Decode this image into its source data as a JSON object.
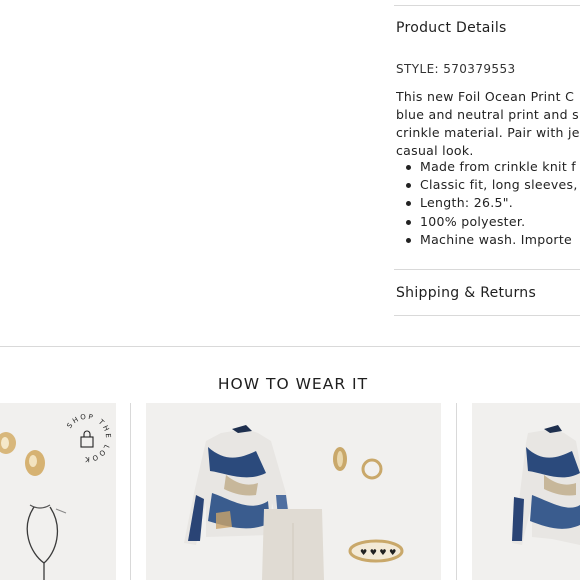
{
  "details": {
    "title": "Product Details",
    "style": "STYLE: 570379553",
    "description_lines": [
      "This new Foil Ocean Print C",
      "blue and neutral print and s",
      "crinkle material. Pair with je",
      "casual look."
    ],
    "bullets": [
      "Made from crinkle knit f",
      "Classic fit, long sleeves,",
      "Length: 26.5\".",
      "100% polyester.",
      "Machine wash. Importe"
    ]
  },
  "shipping": {
    "title": "Shipping & Returns"
  },
  "how_to_wear": {
    "title": "HOW TO WEAR IT",
    "shop_the_look": "SHOP THE LOOK"
  },
  "colors": {
    "rule": "#d9d9d9",
    "card_bg": "#f1f0ee",
    "navy": "#24406e",
    "gold": "#c9a86a"
  }
}
